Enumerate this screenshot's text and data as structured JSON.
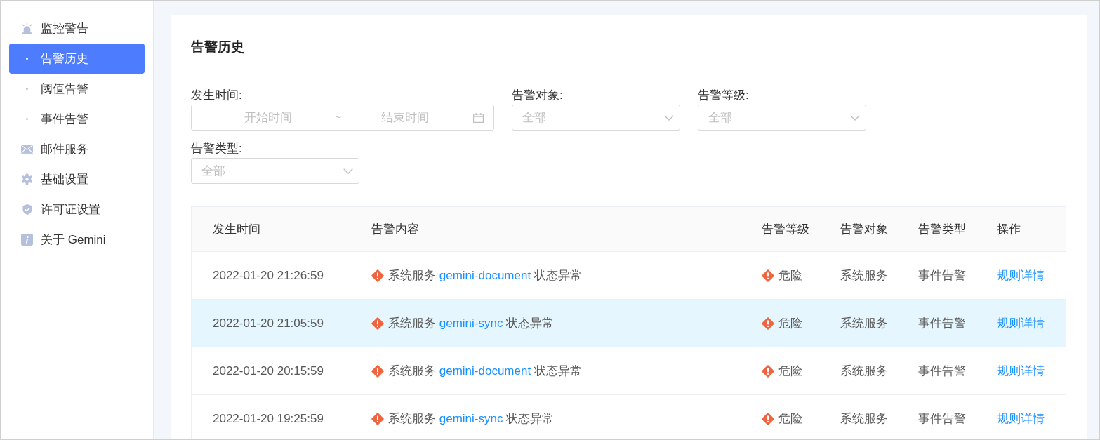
{
  "sidebar": {
    "items": [
      {
        "label": "监控警告",
        "selected": false,
        "children": [
          {
            "label": "告警历史",
            "selected": true
          },
          {
            "label": "阈值告警",
            "selected": false
          },
          {
            "label": "事件告警",
            "selected": false
          }
        ]
      },
      {
        "label": "邮件服务",
        "selected": false
      },
      {
        "label": "基础设置",
        "selected": false
      },
      {
        "label": "许可证设置",
        "selected": false
      },
      {
        "label": "关于 Gemini",
        "selected": false
      }
    ]
  },
  "page": {
    "title": "告警历史"
  },
  "filters": [
    {
      "kind": "date_range",
      "label": "发生时间:",
      "start_placeholder": "开始时间",
      "separator": "~",
      "end_placeholder": "结束时间"
    },
    {
      "kind": "select",
      "label": "告警对象:",
      "placeholder": "全部"
    },
    {
      "kind": "select",
      "label": "告警等级:",
      "placeholder": "全部"
    },
    {
      "kind": "select",
      "label": "告警类型:",
      "placeholder": "全部"
    }
  ],
  "table": {
    "columns": [
      "发生时间",
      "告警内容",
      "告警等级",
      "告警对象",
      "告警类型",
      "操作"
    ],
    "rows": [
      {
        "selected": false,
        "time": "2022-01-20 21:26:59",
        "content": {
          "prefix": "系统服务",
          "link": "gemini-document",
          "suffix": "状态异常"
        },
        "severity": "危险",
        "target": "系统服务",
        "alert_type": "事件告警",
        "action": "规则详情"
      },
      {
        "selected": true,
        "time": "2022-01-20 21:05:59",
        "content": {
          "prefix": "系统服务",
          "link": "gemini-sync",
          "suffix": "状态异常"
        },
        "severity": "危险",
        "target": "系统服务",
        "alert_type": "事件告警",
        "action": "规则详情"
      },
      {
        "selected": false,
        "time": "2022-01-20 20:15:59",
        "content": {
          "prefix": "系统服务",
          "link": "gemini-document",
          "suffix": "状态异常"
        },
        "severity": "危险",
        "target": "系统服务",
        "alert_type": "事件告警",
        "action": "规则详情"
      },
      {
        "selected": false,
        "time": "2022-01-20 19:25:59",
        "content": {
          "prefix": "系统服务",
          "link": "gemini-sync",
          "suffix": "状态异常"
        },
        "severity": "危险",
        "target": "系统服务",
        "alert_type": "事件告警",
        "action": "规则详情"
      }
    ]
  }
}
